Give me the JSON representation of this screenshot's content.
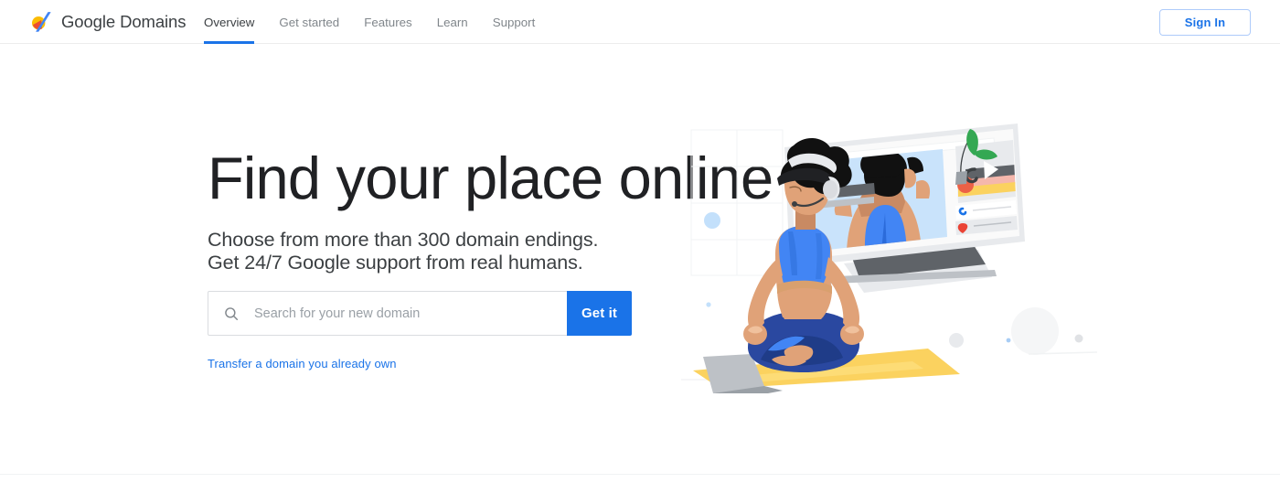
{
  "header": {
    "brand_name": "Google Domains",
    "logo_icon": "google-domains-logo",
    "nav": [
      {
        "label": "Overview",
        "active": true
      },
      {
        "label": "Get started",
        "active": false
      },
      {
        "label": "Features",
        "active": false
      },
      {
        "label": "Learn",
        "active": false
      },
      {
        "label": "Support",
        "active": false
      }
    ],
    "sign_in_label": "Sign In"
  },
  "hero": {
    "title": "Find your place online",
    "subtitle_line1": "Choose from more than 300 domain endings.",
    "subtitle_line2": "Get 24/7 Google support from real humans.",
    "search": {
      "icon": "search-icon",
      "value": "",
      "placeholder": "Search for your new domain",
      "button_label": "Get it"
    },
    "transfer_link_label": "Transfer a domain you already own"
  },
  "illustration": {
    "name": "yoga-video-call-illustration",
    "elements": [
      "background-grid",
      "blue-dot",
      "browser-window",
      "video-frame",
      "instructor-figure",
      "sidebar-card",
      "play-button",
      "plant",
      "phone-row",
      "location-row",
      "monitor-stand",
      "meditating-woman",
      "yoga-mat",
      "laptop",
      "decorative-circles"
    ]
  },
  "colors": {
    "brand_blue": "#1a73e8",
    "blue_mid": "#4285f4",
    "blue_light": "#aecbfa",
    "blue_pale": "#c9e3fb",
    "text_dark": "#202124",
    "text_body": "#3c4043",
    "text_muted": "#80868b",
    "placeholder": "#9aa0a6",
    "border": "#dadce0",
    "yellow": "#fbd25f",
    "yellow_light": "#fddf7d",
    "green": "#34a853",
    "green_leaf": "#34a853",
    "red": "#ea4335",
    "orange_red": "#ec6147",
    "skin": "#e0a278",
    "skin_dark": "#c98a63",
    "navy": "#1f3c88",
    "gray_light": "#f1f3f4",
    "gray_mid": "#bdc1c6",
    "gray_dark": "#5f6368"
  }
}
